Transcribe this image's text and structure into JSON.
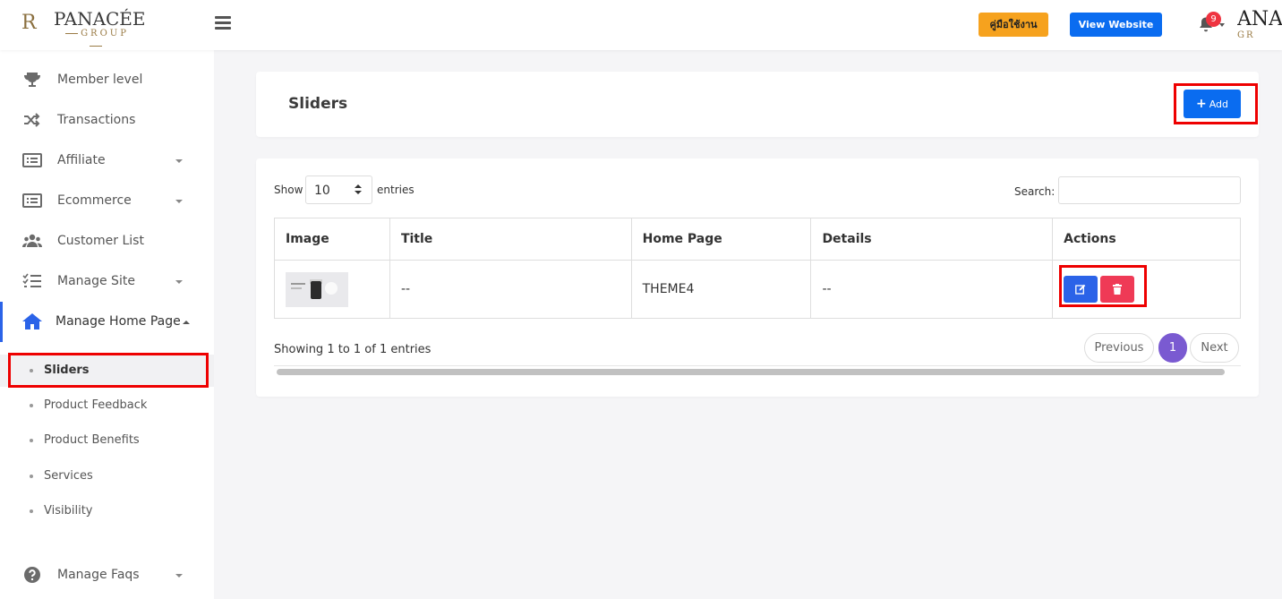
{
  "header": {
    "logo": {
      "monogram": "R",
      "brand": "PANACÉE",
      "group": "GROUP"
    },
    "manual_button": "คู่มือใช้งาน",
    "view_website_button": "View Website",
    "notification_count": "9",
    "logo_right": {
      "brand": "ANA",
      "group": "GR"
    }
  },
  "sidebar": {
    "items": [
      {
        "label": "Member level",
        "icon": "trophy-icon",
        "dropdown": false
      },
      {
        "label": "Transactions",
        "icon": "shuffle-icon",
        "dropdown": false
      },
      {
        "label": "Affiliate",
        "icon": "list-icon",
        "dropdown": true
      },
      {
        "label": "Ecommerce",
        "icon": "list-icon",
        "dropdown": true
      },
      {
        "label": "Customer List",
        "icon": "users-icon",
        "dropdown": false
      },
      {
        "label": "Manage Site",
        "icon": "tasks-icon",
        "dropdown": true
      },
      {
        "label": "Manage Home Page",
        "icon": "home-icon",
        "dropdown": true,
        "active": true
      }
    ],
    "sub_items": [
      {
        "label": "Sliders",
        "active": true
      },
      {
        "label": "Product Feedback"
      },
      {
        "label": "Product Benefits"
      },
      {
        "label": "Services"
      },
      {
        "label": "Visibility"
      }
    ],
    "bottom_item": {
      "label": "Manage Faqs",
      "icon": "question-circle-icon",
      "dropdown": true
    }
  },
  "page": {
    "title": "Sliders",
    "add_button": "Add"
  },
  "table_controls": {
    "show_label": "Show",
    "entries_value": "10",
    "entries_label": "entries",
    "search_label": "Search:",
    "search_value": ""
  },
  "table": {
    "columns": [
      "Image",
      "Title",
      "Home Page",
      "Details",
      "Actions"
    ],
    "rows": [
      {
        "image": "slider-thumbnail",
        "title": "--",
        "home_page": "THEME4",
        "details": "--"
      }
    ]
  },
  "footer": {
    "info": "Showing 1 to 1 of 1 entries",
    "previous": "Previous",
    "current_page": "1",
    "next": "Next"
  },
  "colors": {
    "primary": "#0a6cf0",
    "manual_button": "#f6a21e",
    "delete": "#ef3a56",
    "active_page": "#7a5ad1",
    "highlight": "#ee0000"
  }
}
